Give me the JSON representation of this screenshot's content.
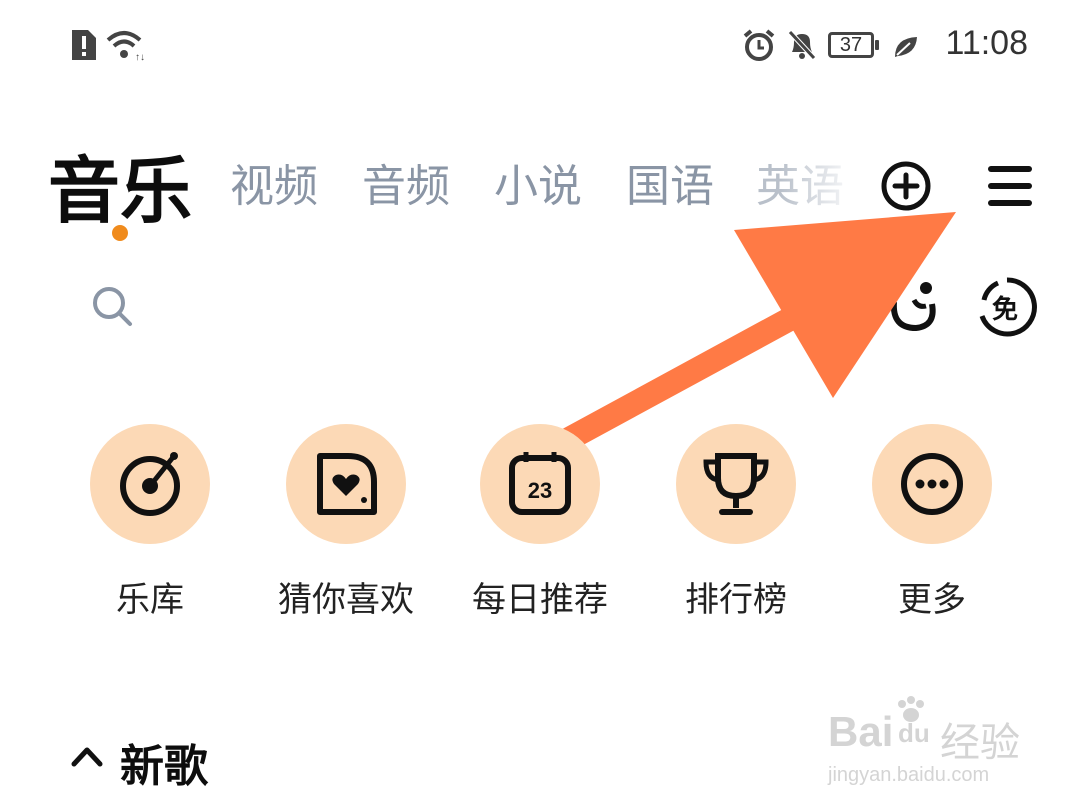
{
  "status_bar": {
    "time": "11:08",
    "battery": "37",
    "icons": [
      "sim-alert-icon",
      "wifi-icon",
      "alarm-icon",
      "mute-icon",
      "battery-icon",
      "leaf-icon"
    ]
  },
  "tabs": {
    "active": "音乐",
    "items": [
      "视频",
      "音频",
      "小说",
      "国语",
      "英语"
    ]
  },
  "header_icons": [
    "add-circle-icon",
    "menu-icon"
  ],
  "search": {
    "icons": [
      "search-icon",
      "mascot-icon",
      "free-badge-icon"
    ]
  },
  "quick_entries": [
    {
      "label": "乐库",
      "icon": "record-icon"
    },
    {
      "label": "猜你喜欢",
      "icon": "heart-disc-icon"
    },
    {
      "label": "每日推荐",
      "icon": "calendar-icon",
      "badge": "23"
    },
    {
      "label": "排行榜",
      "icon": "trophy-icon"
    },
    {
      "label": "更多",
      "icon": "more-icon"
    }
  ],
  "section": {
    "title": "新歌",
    "collapse_icon": "chevron-up-icon"
  },
  "annotation": {
    "type": "arrow",
    "color": "#ff7a45",
    "points_to": "menu-icon"
  },
  "watermark": {
    "brand": "Bai",
    "brand_suffix": "du",
    "site_label": "经验",
    "url": "jingyan.baidu.com"
  },
  "colors": {
    "accent": "#f08b1d",
    "entry_bg": "#fcd9b6",
    "inactive_tab": "#8a95a5",
    "annotation_arrow": "#ff7a45"
  }
}
